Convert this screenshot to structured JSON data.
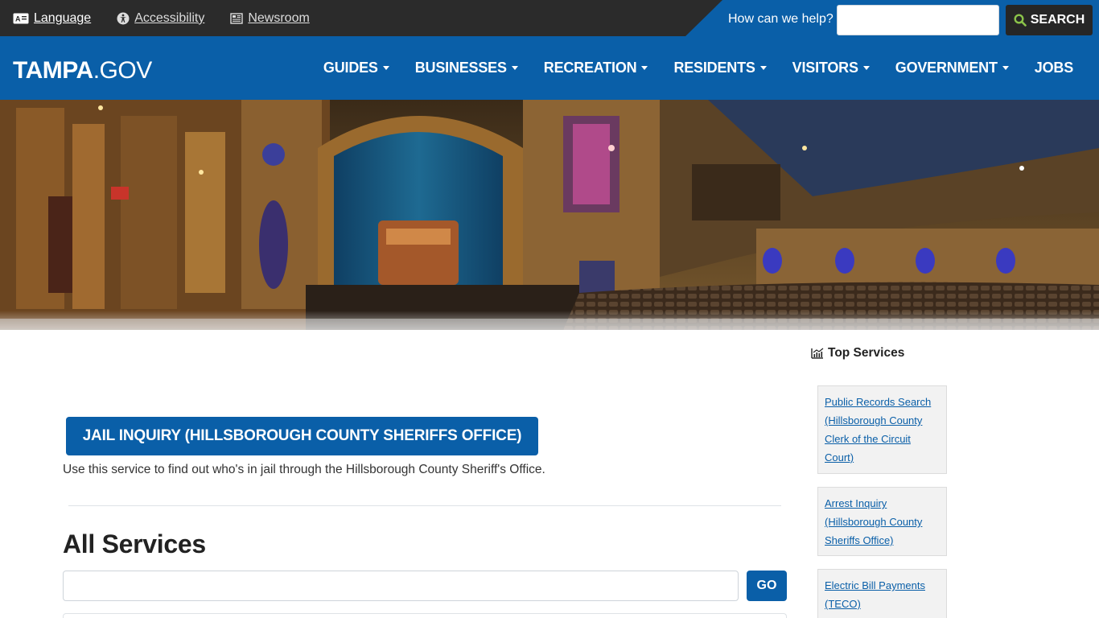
{
  "utility": {
    "language_label": "Language",
    "accessibility_label": "Accessibility",
    "newsroom_label": "Newsroom",
    "help_label": "How can we help?",
    "search_value": "",
    "search_button_label": "SEARCH"
  },
  "nav": {
    "logo_bold": "TAMPA",
    "logo_thin": ".GOV",
    "items": [
      {
        "label": "GUIDES"
      },
      {
        "label": "BUSINESSES"
      },
      {
        "label": "RECREATION"
      },
      {
        "label": "RESIDENTS"
      },
      {
        "label": "VISITORS"
      },
      {
        "label": "GOVERNMENT"
      },
      {
        "label": "JOBS"
      }
    ]
  },
  "main": {
    "jail_button_label": "JAIL INQUIRY (HILLSBOROUGH COUNTY SHERIFFS OFFICE)",
    "jail_description": "Use this service to find out who's in jail through the Hillsborough County Sheriff's Office.",
    "all_services_heading": "All Services",
    "services_search_value": "",
    "go_button_label": "GO"
  },
  "sidebar": {
    "heading": "Top Services",
    "services": [
      {
        "label": "Public Records Search (Hillsborough County Clerk of the Circuit Court)"
      },
      {
        "label": "Arrest Inquiry (Hillsborough County Sheriffs Office)"
      },
      {
        "label": "Electric Bill Payments (TECO)"
      }
    ]
  },
  "colors": {
    "brand_blue": "#0a5fa8",
    "utility_bar": "#2b2b2b",
    "search_icon": "#8bc34a"
  }
}
